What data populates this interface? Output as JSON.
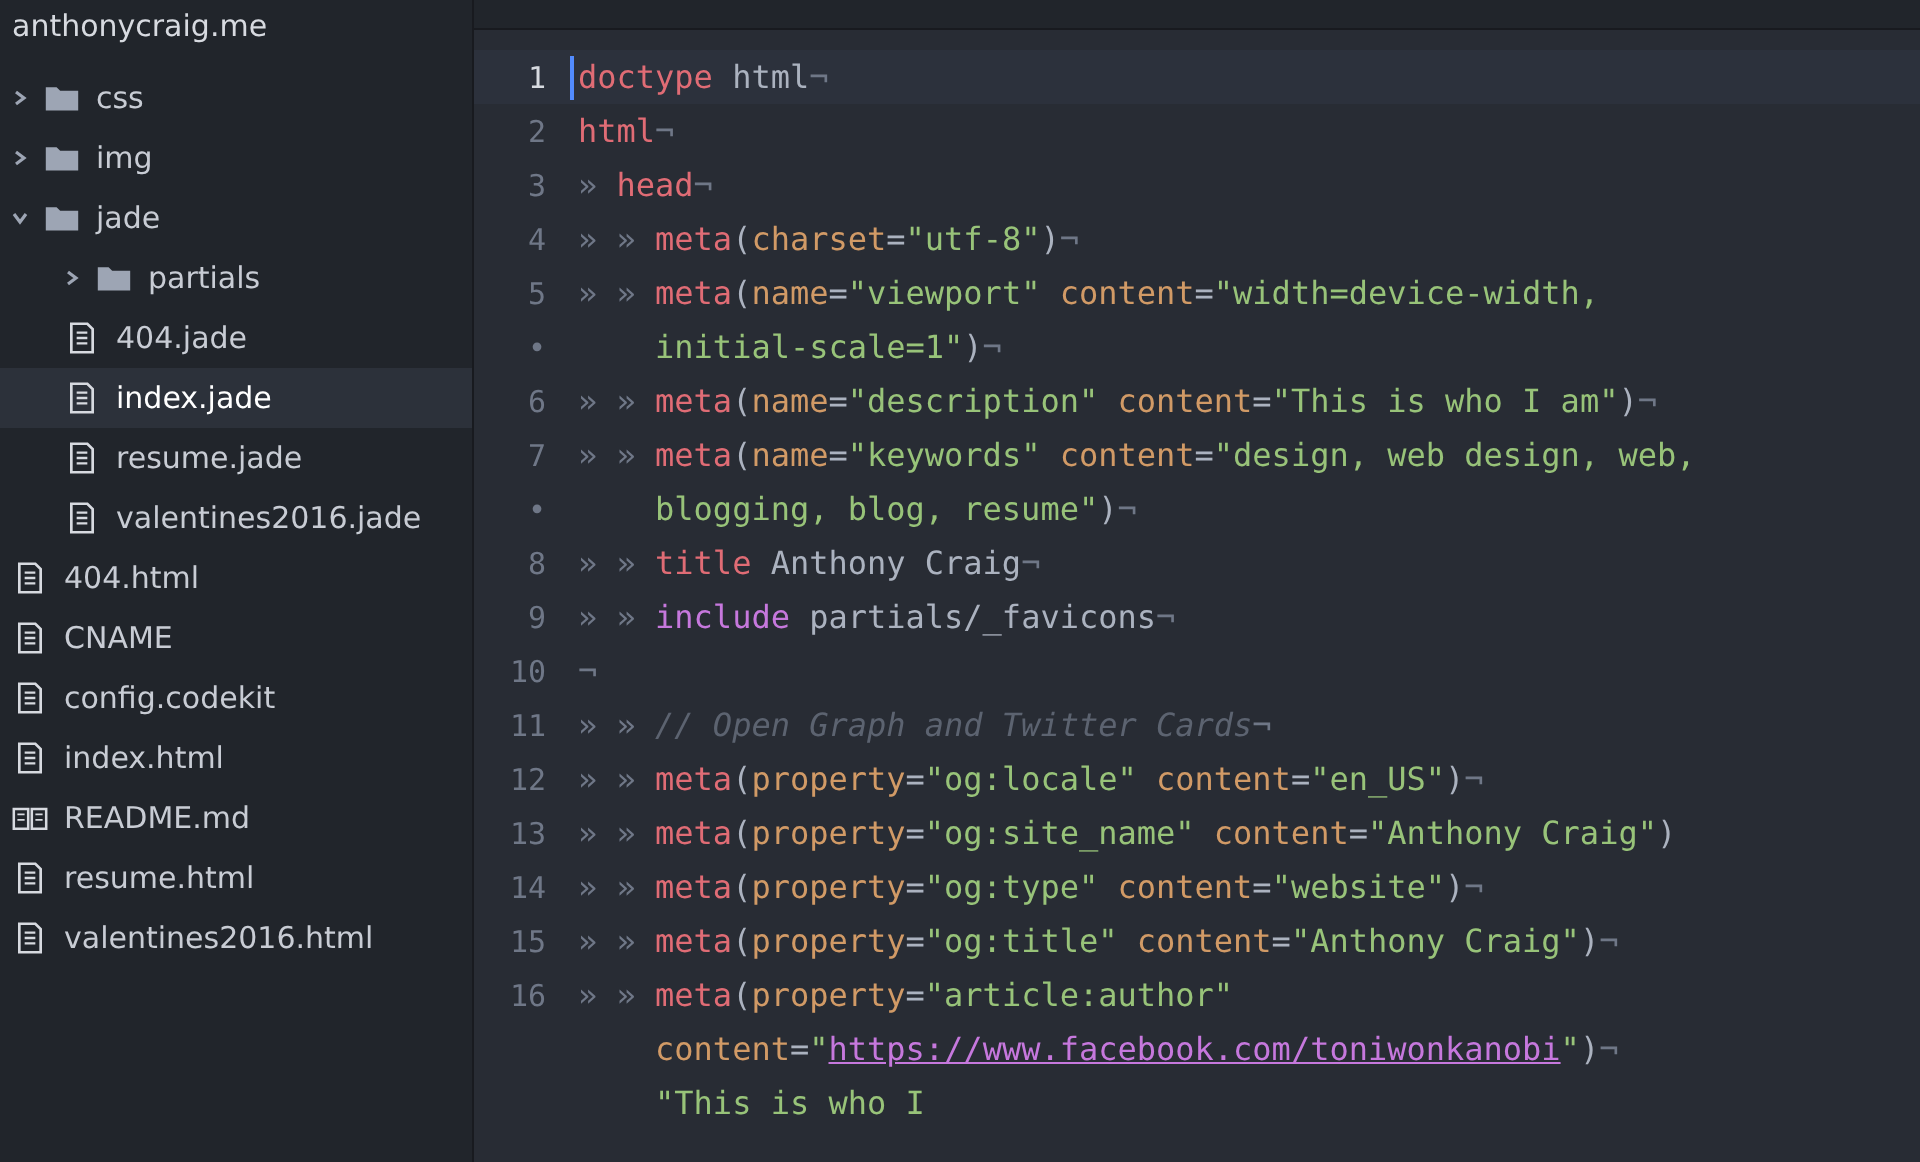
{
  "sidebar": {
    "title": "anthonycraig.me",
    "items": [
      {
        "kind": "folder",
        "name": "css",
        "expanded": false,
        "selected": false
      },
      {
        "kind": "folder",
        "name": "img",
        "expanded": false,
        "selected": false
      },
      {
        "kind": "folder",
        "name": "jade",
        "expanded": true,
        "selected": false,
        "children": [
          {
            "kind": "folder",
            "name": "partials",
            "expanded": false,
            "selected": false
          },
          {
            "kind": "file",
            "name": "404.jade",
            "selected": false
          },
          {
            "kind": "file",
            "name": "index.jade",
            "selected": true
          },
          {
            "kind": "file",
            "name": "resume.jade",
            "selected": false
          },
          {
            "kind": "file",
            "name": "valentines2016.jade",
            "selected": false
          }
        ]
      },
      {
        "kind": "file",
        "name": "404.html",
        "selected": false
      },
      {
        "kind": "file",
        "name": "CNAME",
        "selected": false
      },
      {
        "kind": "file",
        "name": "config.codekit",
        "selected": false
      },
      {
        "kind": "file",
        "name": "index.html",
        "selected": false
      },
      {
        "kind": "readme",
        "name": "README.md",
        "selected": false
      },
      {
        "kind": "file",
        "name": "resume.html",
        "selected": false
      },
      {
        "kind": "file",
        "name": "valentines2016.html",
        "selected": false
      }
    ]
  },
  "editor": {
    "lines": [
      {
        "gutter": "1",
        "active": true,
        "tokens": [
          {
            "kind": "tag",
            "text": "doctype"
          },
          {
            "kind": "plain",
            "text": " html"
          },
          {
            "kind": "invisible",
            "text": "¬"
          }
        ]
      },
      {
        "gutter": "2",
        "active": false,
        "tokens": [
          {
            "kind": "tag",
            "text": "html"
          },
          {
            "kind": "invisible",
            "text": "¬"
          }
        ]
      },
      {
        "gutter": "3",
        "active": false,
        "tokens": [
          {
            "kind": "indent",
            "text": "»"
          },
          {
            "kind": "tag",
            "text": "head"
          },
          {
            "kind": "invisible",
            "text": "¬"
          }
        ]
      },
      {
        "gutter": "4",
        "active": false,
        "tokens": [
          {
            "kind": "indent",
            "text": "»"
          },
          {
            "kind": "indent",
            "text": "»"
          },
          {
            "kind": "tag",
            "text": "meta"
          },
          {
            "kind": "plain",
            "text": "("
          },
          {
            "kind": "attr",
            "text": "charset"
          },
          {
            "kind": "plain",
            "text": "="
          },
          {
            "kind": "string",
            "text": "\"utf-8\""
          },
          {
            "kind": "plain",
            "text": ")"
          },
          {
            "kind": "invisible",
            "text": "¬"
          }
        ]
      },
      {
        "gutter": "5",
        "active": false,
        "tokens": [
          {
            "kind": "indent",
            "text": "»"
          },
          {
            "kind": "indent",
            "text": "»"
          },
          {
            "kind": "tag",
            "text": "meta"
          },
          {
            "kind": "plain",
            "text": "("
          },
          {
            "kind": "attr",
            "text": "name"
          },
          {
            "kind": "plain",
            "text": "="
          },
          {
            "kind": "string",
            "text": "\"viewport\""
          },
          {
            "kind": "attr",
            "text": " content"
          },
          {
            "kind": "plain",
            "text": "="
          },
          {
            "kind": "string",
            "text": "\"width=device-width,"
          }
        ]
      },
      {
        "gutter": "•",
        "active": false,
        "tokens": [
          {
            "kind": "wrap"
          },
          {
            "kind": "string",
            "text": "initial-scale=1\""
          },
          {
            "kind": "plain",
            "text": ")"
          },
          {
            "kind": "invisible",
            "text": "¬"
          }
        ]
      },
      {
        "gutter": "6",
        "active": false,
        "tokens": [
          {
            "kind": "indent",
            "text": "»"
          },
          {
            "kind": "indent",
            "text": "»"
          },
          {
            "kind": "tag",
            "text": "meta"
          },
          {
            "kind": "plain",
            "text": "("
          },
          {
            "kind": "attr",
            "text": "name"
          },
          {
            "kind": "plain",
            "text": "="
          },
          {
            "kind": "string",
            "text": "\"description\""
          },
          {
            "kind": "attr",
            "text": " content"
          },
          {
            "kind": "plain",
            "text": "="
          },
          {
            "kind": "string",
            "text": "\"This is who I am\""
          },
          {
            "kind": "plain",
            "text": ")"
          },
          {
            "kind": "invisible",
            "text": "¬"
          }
        ]
      },
      {
        "gutter": "7",
        "active": false,
        "tokens": [
          {
            "kind": "indent",
            "text": "»"
          },
          {
            "kind": "indent",
            "text": "»"
          },
          {
            "kind": "tag",
            "text": "meta"
          },
          {
            "kind": "plain",
            "text": "("
          },
          {
            "kind": "attr",
            "text": "name"
          },
          {
            "kind": "plain",
            "text": "="
          },
          {
            "kind": "string",
            "text": "\"keywords\""
          },
          {
            "kind": "attr",
            "text": " content"
          },
          {
            "kind": "plain",
            "text": "="
          },
          {
            "kind": "string",
            "text": "\"design, web design, web,"
          }
        ]
      },
      {
        "gutter": "•",
        "active": false,
        "tokens": [
          {
            "kind": "wrap"
          },
          {
            "kind": "string",
            "text": "blogging, blog, resume\""
          },
          {
            "kind": "plain",
            "text": ")"
          },
          {
            "kind": "invisible",
            "text": "¬"
          }
        ]
      },
      {
        "gutter": "8",
        "active": false,
        "tokens": [
          {
            "kind": "indent",
            "text": "»"
          },
          {
            "kind": "indent",
            "text": "»"
          },
          {
            "kind": "tag",
            "text": "title"
          },
          {
            "kind": "plain",
            "text": " Anthony Craig"
          },
          {
            "kind": "invisible",
            "text": "¬"
          }
        ]
      },
      {
        "gutter": "9",
        "active": false,
        "tokens": [
          {
            "kind": "indent",
            "text": "»"
          },
          {
            "kind": "indent",
            "text": "»"
          },
          {
            "kind": "keyword",
            "text": "include"
          },
          {
            "kind": "plain",
            "text": " partials/_favicons"
          },
          {
            "kind": "invisible",
            "text": "¬"
          }
        ]
      },
      {
        "gutter": "10",
        "active": false,
        "tokens": [
          {
            "kind": "invisible",
            "text": "¬"
          }
        ]
      },
      {
        "gutter": "11",
        "active": false,
        "tokens": [
          {
            "kind": "indent",
            "text": "»"
          },
          {
            "kind": "indent",
            "text": "»"
          },
          {
            "kind": "comment",
            "text": "// Open Graph and Twitter Cards"
          },
          {
            "kind": "invisible",
            "text": "¬"
          }
        ]
      },
      {
        "gutter": "12",
        "active": false,
        "tokens": [
          {
            "kind": "indent",
            "text": "»"
          },
          {
            "kind": "indent",
            "text": "»"
          },
          {
            "kind": "tag",
            "text": "meta"
          },
          {
            "kind": "plain",
            "text": "("
          },
          {
            "kind": "attr",
            "text": "property"
          },
          {
            "kind": "plain",
            "text": "="
          },
          {
            "kind": "string",
            "text": "\"og:locale\""
          },
          {
            "kind": "attr",
            "text": " content"
          },
          {
            "kind": "plain",
            "text": "="
          },
          {
            "kind": "string",
            "text": "\"en_US\""
          },
          {
            "kind": "plain",
            "text": ")"
          },
          {
            "kind": "invisible",
            "text": "¬"
          }
        ]
      },
      {
        "gutter": "13",
        "active": false,
        "tokens": [
          {
            "kind": "indent",
            "text": "»"
          },
          {
            "kind": "indent",
            "text": "»"
          },
          {
            "kind": "tag",
            "text": "meta"
          },
          {
            "kind": "plain",
            "text": "("
          },
          {
            "kind": "attr",
            "text": "property"
          },
          {
            "kind": "plain",
            "text": "="
          },
          {
            "kind": "string",
            "text": "\"og:site_name\""
          },
          {
            "kind": "attr",
            "text": " content"
          },
          {
            "kind": "plain",
            "text": "="
          },
          {
            "kind": "string",
            "text": "\"Anthony Craig\""
          },
          {
            "kind": "plain",
            "text": ")"
          }
        ]
      },
      {
        "gutter": "14",
        "active": false,
        "tokens": [
          {
            "kind": "indent",
            "text": "»"
          },
          {
            "kind": "indent",
            "text": "»"
          },
          {
            "kind": "tag",
            "text": "meta"
          },
          {
            "kind": "plain",
            "text": "("
          },
          {
            "kind": "attr",
            "text": "property"
          },
          {
            "kind": "plain",
            "text": "="
          },
          {
            "kind": "string",
            "text": "\"og:type\""
          },
          {
            "kind": "attr",
            "text": " content"
          },
          {
            "kind": "plain",
            "text": "="
          },
          {
            "kind": "string",
            "text": "\"website\""
          },
          {
            "kind": "plain",
            "text": ")"
          },
          {
            "kind": "invisible",
            "text": "¬"
          }
        ]
      },
      {
        "gutter": "15",
        "active": false,
        "tokens": [
          {
            "kind": "indent",
            "text": "»"
          },
          {
            "kind": "indent",
            "text": "»"
          },
          {
            "kind": "tag",
            "text": "meta"
          },
          {
            "kind": "plain",
            "text": "("
          },
          {
            "kind": "attr",
            "text": "property"
          },
          {
            "kind": "plain",
            "text": "="
          },
          {
            "kind": "string",
            "text": "\"og:title\""
          },
          {
            "kind": "attr",
            "text": " content"
          },
          {
            "kind": "plain",
            "text": "="
          },
          {
            "kind": "string",
            "text": "\"Anthony Craig\""
          },
          {
            "kind": "plain",
            "text": ")"
          },
          {
            "kind": "invisible",
            "text": "¬"
          }
        ]
      },
      {
        "gutter": "16",
        "active": false,
        "tokens": [
          {
            "kind": "indent",
            "text": "»"
          },
          {
            "kind": "indent",
            "text": "»"
          },
          {
            "kind": "tag",
            "text": "meta"
          },
          {
            "kind": "plain",
            "text": "("
          },
          {
            "kind": "attr",
            "text": "property"
          },
          {
            "kind": "plain",
            "text": "="
          },
          {
            "kind": "string",
            "text": "\"article:author\""
          }
        ]
      },
      {
        "active": false,
        "tokens": [
          {
            "kind": "wrap"
          },
          {
            "kind": "attr",
            "text": "content"
          },
          {
            "kind": "plain",
            "text": "="
          },
          {
            "kind": "string",
            "text": "\""
          },
          {
            "kind": "link",
            "text": "https://www.facebook.com/toniwonkanobi"
          },
          {
            "kind": "string",
            "text": "\""
          },
          {
            "kind": "plain",
            "text": ")"
          },
          {
            "kind": "invisible",
            "text": "¬"
          }
        ]
      },
      {
        "active": false,
        "tokens": [
          {
            "kind": "wrap"
          },
          {
            "kind": "string",
            "text": "\"This is who I"
          }
        ]
      }
    ]
  }
}
